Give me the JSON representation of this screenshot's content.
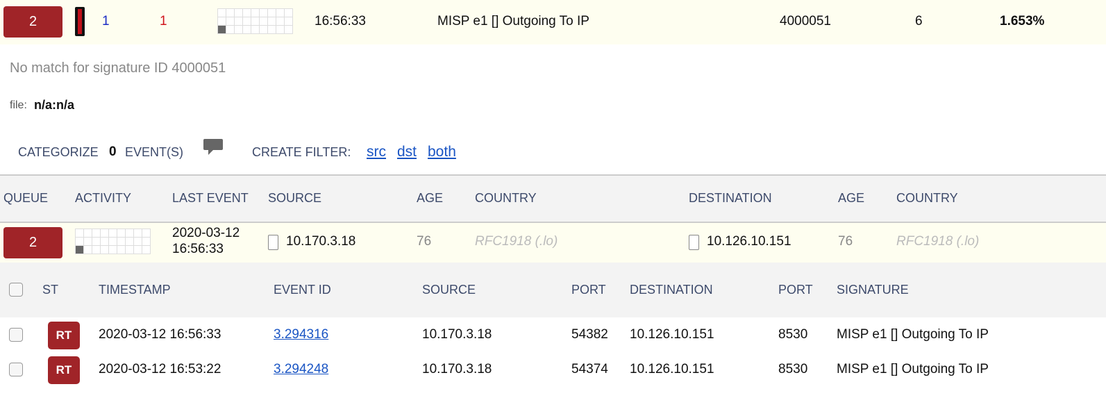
{
  "summary": {
    "queue_count": "2",
    "src_count": "1",
    "dst_count": "1",
    "time": "16:56:33",
    "signature": "MISP e1 [] Outgoing To IP",
    "signature_id": "4000051",
    "event_count": "6",
    "percent": "1.653%",
    "indicator_color": "#a02428"
  },
  "details": {
    "no_match_text": "No match for signature ID 4000051",
    "file_label": "file:",
    "file_value": "n/a:n/a"
  },
  "actions": {
    "categorize_label": "CATEGORIZE",
    "categorize_count": "0",
    "events_label": "EVENT(S)",
    "comment_icon": "comment-icon",
    "create_filter_label": "CREATE FILTER:",
    "filter_src": "src",
    "filter_dst": "dst",
    "filter_both": "both"
  },
  "queue_table": {
    "headers": {
      "queue": "QUEUE",
      "activity": "ACTIVITY",
      "last_event": "LAST EVENT",
      "source": "SOURCE",
      "age": "AGE",
      "country": "COUNTRY",
      "destination": "DESTINATION",
      "age2": "AGE",
      "country2": "COUNTRY"
    },
    "row": {
      "queue": "2",
      "last_event_date": "2020-03-12",
      "last_event_time": "16:56:33",
      "source": "10.170.3.18",
      "source_age": "76",
      "source_country": "RFC1918 (.lo)",
      "destination": "10.126.10.151",
      "dest_age": "76",
      "dest_country": "RFC1918 (.lo)"
    }
  },
  "events_table": {
    "headers": {
      "st": "ST",
      "timestamp": "TIMESTAMP",
      "event_id": "EVENT ID",
      "source": "SOURCE",
      "port": "PORT",
      "destination": "DESTINATION",
      "port2": "PORT",
      "signature": "SIGNATURE"
    },
    "rows": [
      {
        "st": "RT",
        "timestamp": "2020-03-12 16:56:33",
        "event_id": "3.294316",
        "source": "10.170.3.18",
        "src_port": "54382",
        "destination": "10.126.10.151",
        "dst_port": "8530",
        "signature": "MISP e1 [] Outgoing To IP"
      },
      {
        "st": "RT",
        "timestamp": "2020-03-12 16:53:22",
        "event_id": "3.294248",
        "source": "10.170.3.18",
        "src_port": "54374",
        "destination": "10.126.10.151",
        "dst_port": "8530",
        "signature": "MISP e1 [] Outgoing To IP"
      }
    ]
  }
}
